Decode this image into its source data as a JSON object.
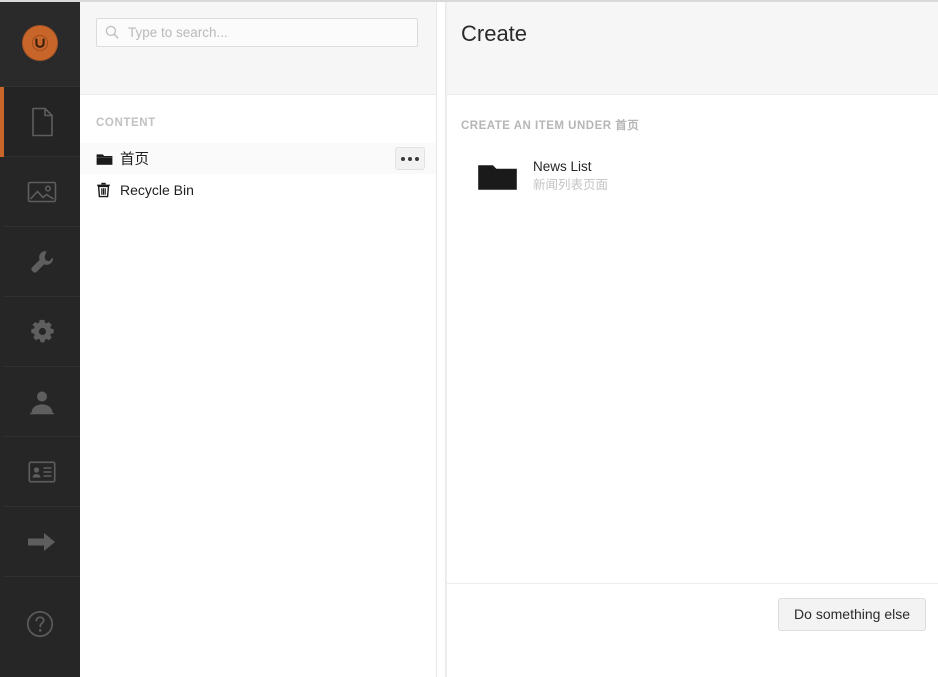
{
  "colors": {
    "brand_orange": "#c8652a",
    "rail_background": "#262626",
    "panel_background": "#f6f6f6",
    "selected_row": "#fafafa"
  },
  "rail": {
    "logo_name": "umbraco-logo",
    "items": [
      {
        "name": "sidebar-item-content",
        "icon": "document-icon",
        "active": true
      },
      {
        "name": "sidebar-item-media",
        "icon": "image-icon",
        "active": false
      },
      {
        "name": "sidebar-item-settings",
        "icon": "wrench-icon",
        "active": false
      },
      {
        "name": "sidebar-item-developer",
        "icon": "gear-icon",
        "active": false
      },
      {
        "name": "sidebar-item-users",
        "icon": "user-icon",
        "active": false
      },
      {
        "name": "sidebar-item-members",
        "icon": "id-card-icon",
        "active": false
      },
      {
        "name": "sidebar-item-forms",
        "icon": "arrow-right-icon",
        "active": false
      }
    ],
    "help": {
      "name": "sidebar-item-help",
      "icon": "help-circle-icon"
    }
  },
  "search": {
    "placeholder": "Type to search...",
    "value": "",
    "icon": "search-icon"
  },
  "tree": {
    "heading": "CONTENT",
    "nodes": [
      {
        "label": "首页",
        "icon": "folder-icon",
        "selected": true,
        "has_options": true,
        "options_label": "•••"
      },
      {
        "label": "Recycle Bin",
        "icon": "trash-icon",
        "selected": false,
        "has_options": false,
        "options_label": ""
      }
    ]
  },
  "editor": {
    "title": "Create",
    "section_label": "CREATE AN ITEM UNDER 首页",
    "create_items": [
      {
        "name": "News List",
        "description": "新闻列表页面",
        "icon": "folder-icon"
      }
    ],
    "footer": {
      "secondary_button": "Do something else"
    }
  }
}
